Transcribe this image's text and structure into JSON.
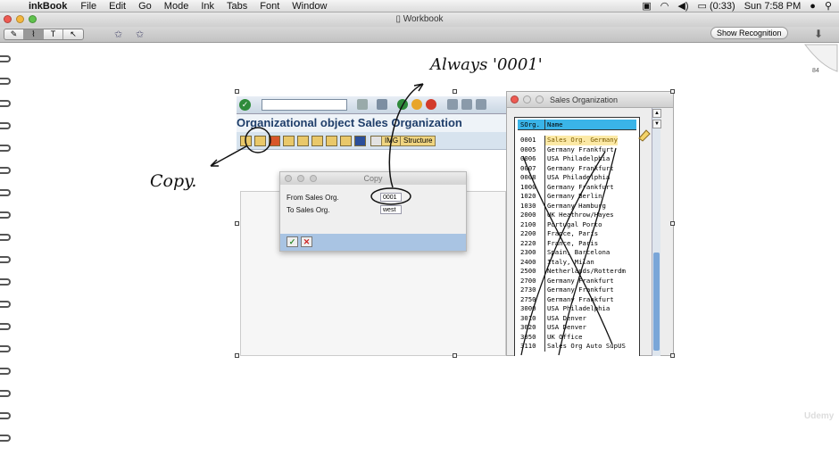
{
  "menubar": {
    "app": "inkBook",
    "items": [
      "File",
      "Edit",
      "Go",
      "Mode",
      "Ink",
      "Tabs",
      "Font",
      "Window"
    ],
    "battery": "(0:33)",
    "clock": "Sun 7:58 PM"
  },
  "window": {
    "title": "Workbook"
  },
  "toolbar": {
    "show_recognition": "Show Recognition",
    "seg_text": "T"
  },
  "page": {
    "number": "84",
    "watermark": "Udemy"
  },
  "sap": {
    "title": "Organizational object Sales Organization",
    "structure_button": "Structure",
    "img_button": "IMG",
    "copy_dialog": {
      "title": "Copy",
      "from_label": "From Sales Org.",
      "from_value": "0001",
      "to_label": "To Sales Org.",
      "to_value": "west"
    },
    "sales_org_dialog": {
      "title": "Sales Organization",
      "headers": [
        "SOrg.",
        "Name"
      ],
      "rows": [
        [
          "0001",
          "Sales Org. Germany"
        ],
        [
          "0005",
          "Germany Frankfurt"
        ],
        [
          "0006",
          "USA Philadelphia"
        ],
        [
          "0007",
          "Germany Frankfurt"
        ],
        [
          "0008",
          "USA Philadelphia"
        ],
        [
          "1000",
          "Germany Frankfurt"
        ],
        [
          "1020",
          "Germany Berlin"
        ],
        [
          "1030",
          "Germany Hamburg"
        ],
        [
          "2000",
          "UK Heathrow/Hayes"
        ],
        [
          "2100",
          "Portugal Porto"
        ],
        [
          "2200",
          "France, Paris"
        ],
        [
          "2220",
          "France, Paris"
        ],
        [
          "2300",
          "Spain, Barcelona"
        ],
        [
          "2400",
          "Italy, Milan"
        ],
        [
          "2500",
          "Netherlands/Rotterdm"
        ],
        [
          "2700",
          "Germany Frankfurt"
        ],
        [
          "2730",
          "Germany Frankfurt"
        ],
        [
          "2750",
          "Germany Frankfurt"
        ],
        [
          "3000",
          "USA Philadelphia"
        ],
        [
          "3010",
          "USA Denver"
        ],
        [
          "3020",
          "USA Denver"
        ],
        [
          "3050",
          "UK Office"
        ],
        [
          "3110",
          "Sales Org Auto SupUS"
        ]
      ]
    }
  },
  "annotations": {
    "always": "Always '0001'",
    "copy": "Copy."
  }
}
